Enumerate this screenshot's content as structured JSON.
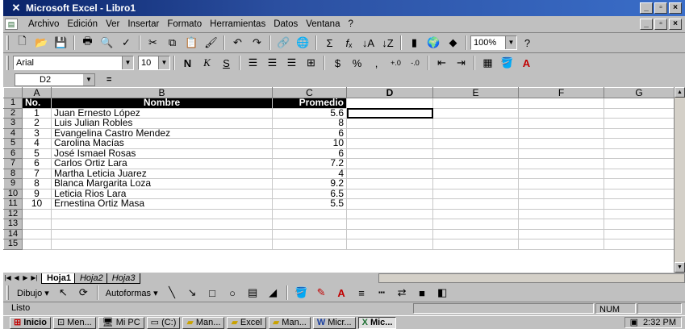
{
  "window": {
    "title": "Microsoft Excel - Libro1",
    "app_icon": "excel-icon",
    "controls": [
      "_",
      "▫",
      "×"
    ]
  },
  "menu": {
    "items": [
      "Archivo",
      "Edición",
      "Ver",
      "Insertar",
      "Formato",
      "Herramientas",
      "Datos",
      "Ventana",
      "?"
    ]
  },
  "toolbar1": {
    "zoom": "100%",
    "buttons": [
      "new-icon",
      "open-icon",
      "save-icon",
      "print-icon",
      "preview-icon",
      "spell-icon",
      "cut-icon",
      "copy-icon",
      "paste-icon",
      "format-painter-icon",
      "undo-icon",
      "redo-icon",
      "hyperlink-icon",
      "web-icon",
      "autosum-icon",
      "function-icon",
      "sort-asc-icon",
      "sort-desc-icon",
      "chart-icon",
      "map-icon",
      "drawing-icon"
    ]
  },
  "toolbar2": {
    "font": "Arial",
    "size": "10"
  },
  "formula": {
    "cell_ref": "D2",
    "equals": "=",
    "content": ""
  },
  "columns": [
    "A",
    "B",
    "C",
    "D",
    "E",
    "F",
    "G"
  ],
  "row_numbers": [
    "1",
    "2",
    "3",
    "4",
    "5",
    "6",
    "7",
    "8",
    "9",
    "10",
    "11",
    "12",
    "13",
    "14",
    "15"
  ],
  "header": {
    "no": "No.",
    "nombre": "Nombre",
    "promedio": "Promedio"
  },
  "rows": [
    {
      "no": "1",
      "nombre": "Juan Ernesto López",
      "promedio": "5.6"
    },
    {
      "no": "2",
      "nombre": "Luis Julian Robles",
      "promedio": "8"
    },
    {
      "no": "3",
      "nombre": "Evangelina Castro Mendez",
      "promedio": "6"
    },
    {
      "no": "4",
      "nombre": "Carolina Macías",
      "promedio": "10"
    },
    {
      "no": "5",
      "nombre": "José Ismael Rosas",
      "promedio": "6"
    },
    {
      "no": "6",
      "nombre": "Carlos Ortiz Lara",
      "promedio": "7.2"
    },
    {
      "no": "7",
      "nombre": "Martha Leticia Juarez",
      "promedio": "4"
    },
    {
      "no": "8",
      "nombre": "Blanca Margarita Loza",
      "promedio": "9.2"
    },
    {
      "no": "9",
      "nombre": "Leticia Rios Lara",
      "promedio": "6.5"
    },
    {
      "no": "10",
      "nombre": "Ernestina Ortiz Masa",
      "promedio": "5.5"
    }
  ],
  "sheets": [
    "Hoja1",
    "Hoja2",
    "Hoja3"
  ],
  "drawing": {
    "dibujo": "Dibujo",
    "autoformas": "Autoformas"
  },
  "status": {
    "text": "Listo",
    "num": "NUM"
  },
  "taskbar": {
    "start": "Inicio",
    "buttons": [
      "Men...",
      "Mi PC",
      "(C:)",
      "Man...",
      "Excel",
      "Man...",
      "Micr...",
      "Mic..."
    ],
    "clock": "2:32 PM"
  }
}
